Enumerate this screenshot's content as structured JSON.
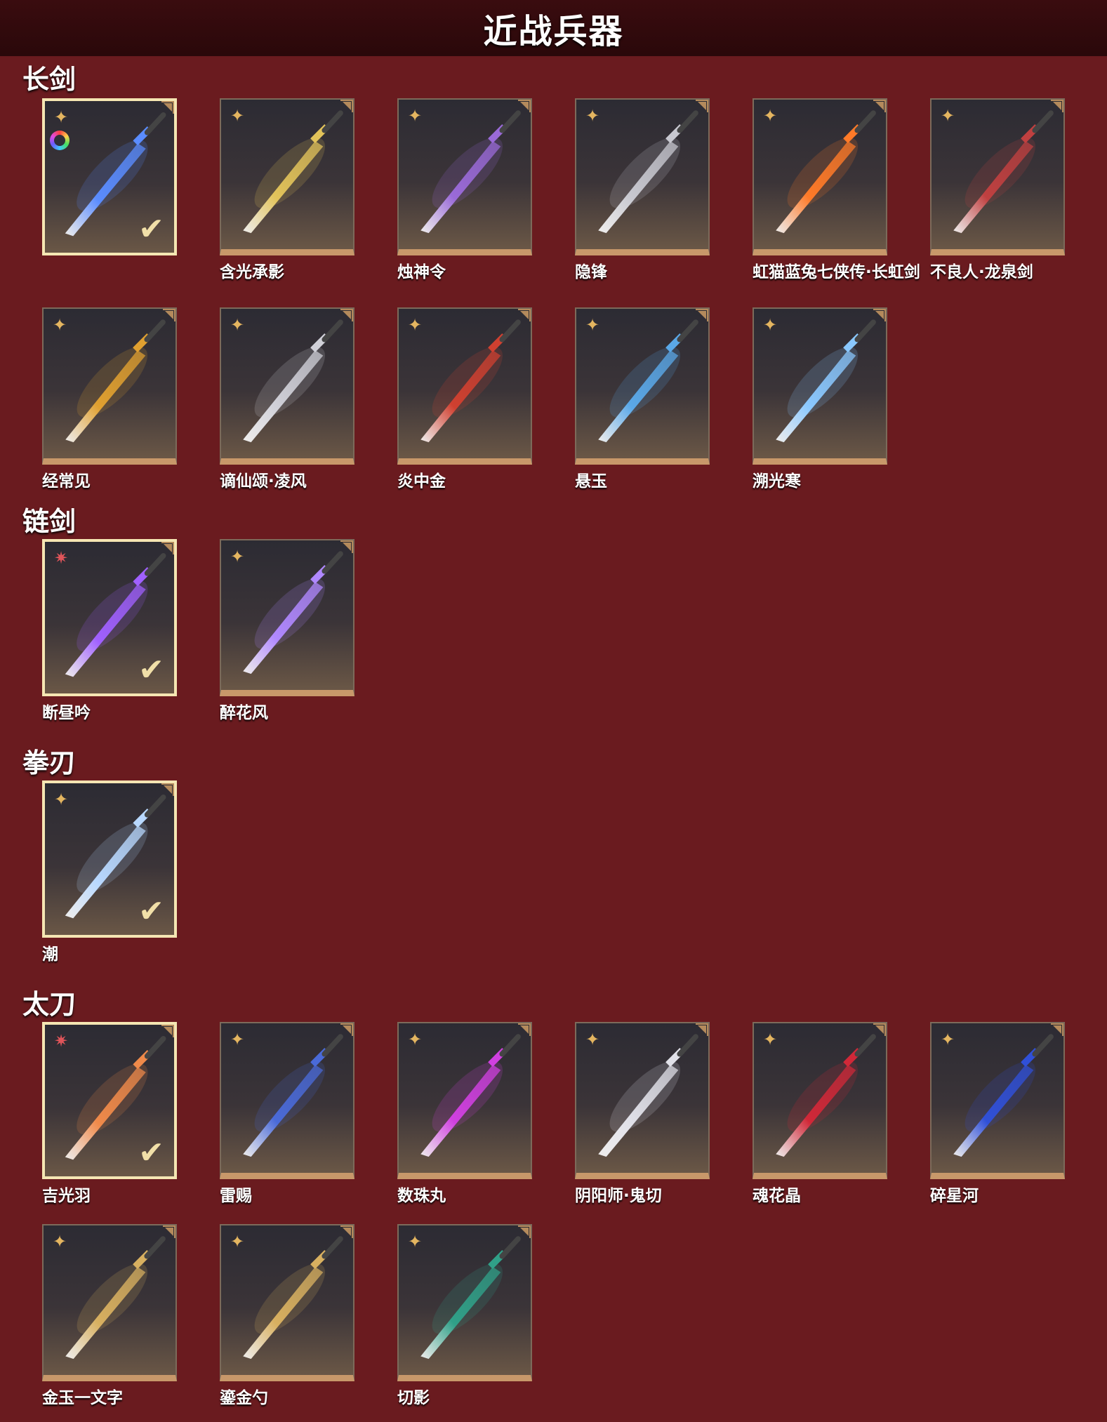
{
  "title": "近战兵器",
  "colors": {
    "background": "#6a1b1f",
    "title_bar": "#2a080a",
    "card_bottom": "#c8986a",
    "selected_border": "#f5e6b3"
  },
  "sections": [
    {
      "id": "changjian",
      "title": "长剑",
      "items": [
        {
          "name": "",
          "rarity": "gold",
          "selected": true,
          "dye_icon": true,
          "color": "#5a8cff"
        },
        {
          "name": "含光承影",
          "rarity": "gold",
          "selected": false,
          "color": "#e2c35a"
        },
        {
          "name": "烛神令",
          "rarity": "gold",
          "selected": false,
          "color": "#9a6ad8"
        },
        {
          "name": "隐锋",
          "rarity": "gold",
          "selected": false,
          "color": "#c8c8d0"
        },
        {
          "name": "虹猫蓝兔七侠传·长虹剑",
          "rarity": "gold",
          "selected": false,
          "color": "#ff7a28"
        },
        {
          "name": "不良人·龙泉剑",
          "rarity": "gold",
          "selected": false,
          "color": "#c04040"
        },
        {
          "name": "经常见",
          "rarity": "gold",
          "selected": false,
          "color": "#e0a030"
        },
        {
          "name": "谪仙颂·凌风",
          "rarity": "gold",
          "selected": false,
          "color": "#d0d0d8"
        },
        {
          "name": "炎中金",
          "rarity": "gold",
          "selected": false,
          "color": "#d04030"
        },
        {
          "name": "悬玉",
          "rarity": "gold",
          "selected": false,
          "color": "#5aa8e8"
        },
        {
          "name": "溯光寒",
          "rarity": "gold",
          "selected": false,
          "color": "#8ac8ff"
        }
      ]
    },
    {
      "id": "lianjian",
      "title": "链剑",
      "items": [
        {
          "name": "断昼吟",
          "rarity": "red",
          "selected": true,
          "color": "#a060ff"
        },
        {
          "name": "醉花风",
          "rarity": "gold",
          "selected": false,
          "color": "#b088ff"
        }
      ]
    },
    {
      "id": "quanren",
      "title": "拳刃",
      "items": [
        {
          "name": "潮",
          "rarity": "gold",
          "selected": true,
          "color": "#b8d8ff"
        }
      ]
    },
    {
      "id": "taidao",
      "title": "太刀",
      "items": [
        {
          "name": "吉光羽",
          "rarity": "red",
          "selected": true,
          "color": "#f08a4a"
        },
        {
          "name": "雷赐",
          "rarity": "gold",
          "selected": false,
          "color": "#4a6ad8"
        },
        {
          "name": "数珠丸",
          "rarity": "gold",
          "selected": false,
          "color": "#d040e0"
        },
        {
          "name": "阴阳师·鬼切",
          "rarity": "gold",
          "selected": false,
          "color": "#e0e0e8"
        },
        {
          "name": "魂花晶",
          "rarity": "gold",
          "selected": false,
          "color": "#d02838"
        },
        {
          "name": "碎星河",
          "rarity": "gold",
          "selected": false,
          "color": "#3050d8"
        },
        {
          "name": "金玉一文字",
          "rarity": "gold",
          "selected": false,
          "color": "#d8b060"
        },
        {
          "name": "鎏金勺",
          "rarity": "gold",
          "selected": false,
          "color": "#d8b060"
        },
        {
          "name": "切影",
          "rarity": "gold",
          "selected": false,
          "color": "#30a088"
        }
      ]
    }
  ]
}
